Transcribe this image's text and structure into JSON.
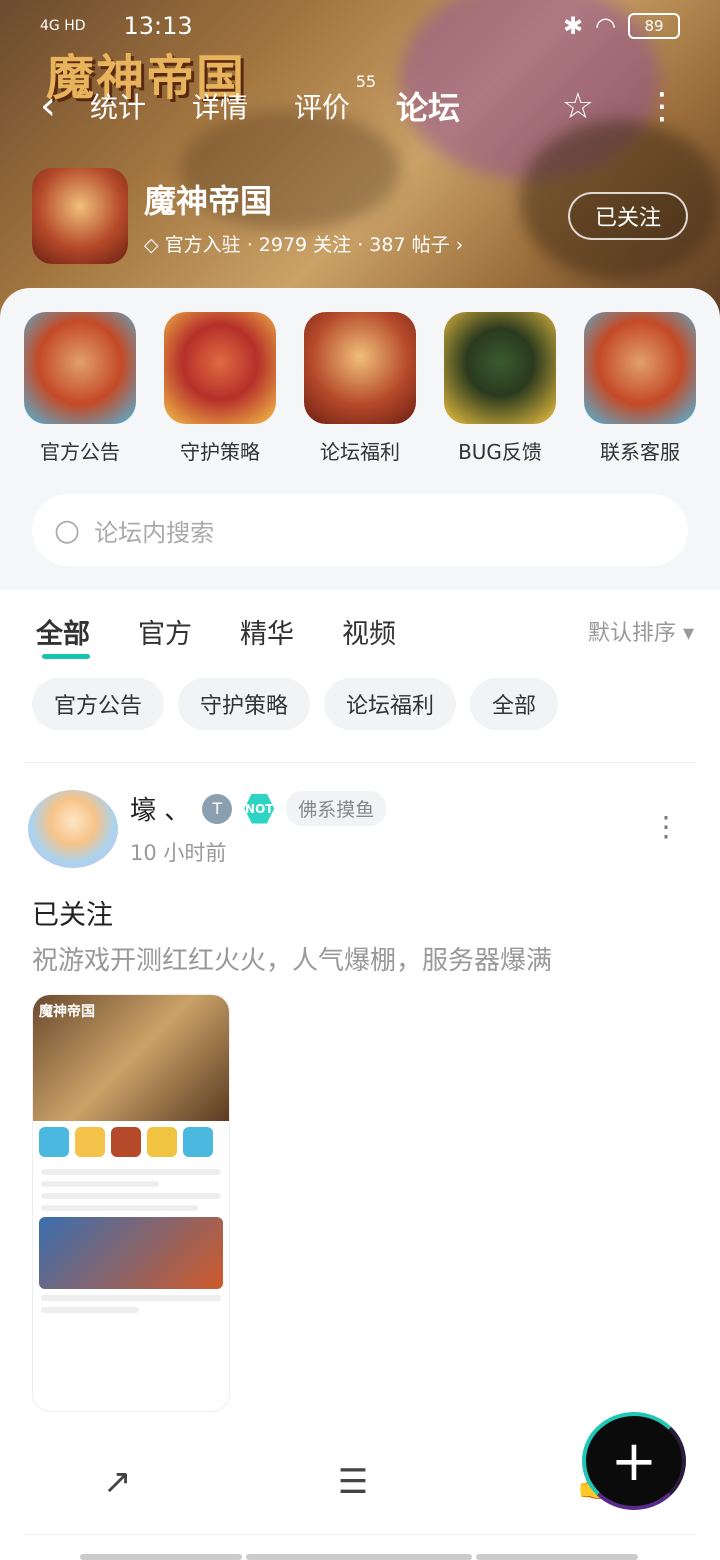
{
  "status": {
    "signal": "4G HD",
    "time": "13:13",
    "battery": "89"
  },
  "game_logo": "魔神帝国",
  "nav": {
    "back_icon": "back-arrow-icon",
    "tabs": [
      {
        "label": "统计"
      },
      {
        "label": "详情"
      },
      {
        "label": "评价",
        "badge": "55"
      },
      {
        "label": "论坛",
        "active": true
      }
    ],
    "star_icon": "star-icon",
    "more_icon": "more-vertical-icon"
  },
  "app": {
    "name": "魔神帝国",
    "meta": "官方入驻 · 2979 关注 · 387 帖子",
    "follow_label": "已关注"
  },
  "categories": [
    {
      "label": "官方公告"
    },
    {
      "label": "守护策略"
    },
    {
      "label": "论坛福利"
    },
    {
      "label": "BUG反馈"
    },
    {
      "label": "联系客服"
    }
  ],
  "search": {
    "placeholder": "论坛内搜索"
  },
  "filters": {
    "tabs": [
      "全部",
      "官方",
      "精华",
      "视频"
    ],
    "sort": "默认排序 ▾"
  },
  "chips": [
    "官方公告",
    "守护策略",
    "论坛福利",
    "全部"
  ],
  "post": {
    "author": "壕 、",
    "badge_t": "T",
    "badge_n": "NOT",
    "tag": "佛系摸鱼",
    "time": "10 小时前",
    "title": "已关注",
    "body": "祝游戏开测红红火火，人气爆棚，服务器爆满",
    "screenshot_title": "魔神帝国"
  },
  "actions": {
    "share_icon": "share-icon",
    "comment_icon": "comment-icon",
    "like_icon": "thumbs-up-icon"
  },
  "fab_label": "+"
}
